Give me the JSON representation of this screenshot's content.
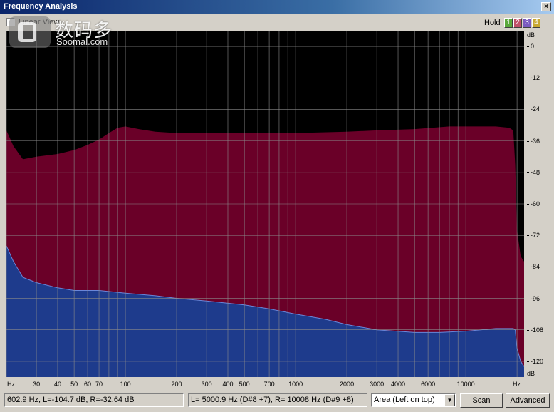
{
  "window": {
    "title": "Frequency Analysis",
    "close_label": "×"
  },
  "toolbar": {
    "linear_view_label": "Linear View",
    "hold_label": "Hold",
    "hold_buttons": [
      {
        "label": "1",
        "color": "#5aa83c"
      },
      {
        "label": "2",
        "color": "#c0506a"
      },
      {
        "label": "3",
        "color": "#7a5abf"
      },
      {
        "label": "4",
        "color": "#c8a832"
      }
    ]
  },
  "watermark": {
    "text_cn": "数码多",
    "text_en": "Soomal.com"
  },
  "chart_data": {
    "type": "area",
    "x_scale": "log",
    "xlim": [
      20,
      22000
    ],
    "ylim": [
      -126,
      6
    ],
    "x_unit": "Hz",
    "y_unit": "dB",
    "x_ticks": [
      {
        "value": 30,
        "label": "30"
      },
      {
        "value": 40,
        "label": "40"
      },
      {
        "value": 50,
        "label": "50"
      },
      {
        "value": 60,
        "label": "60"
      },
      {
        "value": 70,
        "label": "70"
      },
      {
        "value": 100,
        "label": "100"
      },
      {
        "value": 200,
        "label": "200"
      },
      {
        "value": 300,
        "label": "300"
      },
      {
        "value": 400,
        "label": "400"
      },
      {
        "value": 500,
        "label": "500"
      },
      {
        "value": 700,
        "label": "700"
      },
      {
        "value": 1000,
        "label": "1000"
      },
      {
        "value": 2000,
        "label": "2000"
      },
      {
        "value": 3000,
        "label": "3000"
      },
      {
        "value": 4000,
        "label": "4000"
      },
      {
        "value": 6000,
        "label": "6000"
      },
      {
        "value": 10000,
        "label": "10000"
      }
    ],
    "y_ticks": [
      {
        "value": 0,
        "label": "0"
      },
      {
        "value": -12,
        "label": "-12"
      },
      {
        "value": -24,
        "label": "-24"
      },
      {
        "value": -36,
        "label": "-36"
      },
      {
        "value": -48,
        "label": "-48"
      },
      {
        "value": -60,
        "label": "-60"
      },
      {
        "value": -72,
        "label": "-72"
      },
      {
        "value": -84,
        "label": "-84"
      },
      {
        "value": -96,
        "label": "-96"
      },
      {
        "value": -108,
        "label": "-108"
      },
      {
        "value": -120,
        "label": "-120"
      }
    ],
    "grid": true,
    "series": [
      {
        "color": "#6a0028",
        "x": [
          20,
          22,
          25,
          30,
          40,
          50,
          60,
          70,
          80,
          90,
          100,
          120,
          150,
          200,
          300,
          500,
          1000,
          2000,
          3000,
          5000,
          8000,
          10000,
          12000,
          15000,
          18000,
          19000,
          19500,
          20000,
          21000,
          22000
        ],
        "y": [
          -32,
          -38,
          -43,
          -42,
          -41,
          -39.5,
          -37.5,
          -35.5,
          -33,
          -31,
          -30.5,
          -31.5,
          -32.5,
          -33,
          -33,
          -33,
          -33,
          -32.5,
          -32,
          -31.5,
          -30.5,
          -30.5,
          -30.5,
          -30.5,
          -31,
          -32,
          -45,
          -70,
          -80,
          -82
        ]
      },
      {
        "color": "#1e3b8c",
        "x": [
          20,
          22,
          25,
          30,
          40,
          50,
          70,
          100,
          150,
          200,
          300,
          500,
          700,
          1000,
          1500,
          2000,
          3000,
          5000,
          7000,
          10000,
          15000,
          19000,
          19500,
          20000,
          21000,
          22000
        ],
        "y": [
          -76,
          -82,
          -88,
          -90,
          -92,
          -93,
          -93,
          -94,
          -95,
          -96,
          -97,
          -98.5,
          -100,
          -102,
          -104,
          -106,
          -108,
          -109,
          -109,
          -108.5,
          -107.5,
          -107.5,
          -108,
          -115,
          -120,
          -122
        ]
      }
    ]
  },
  "status": {
    "cursor_readout": "602.9 Hz, L=-104.7 dB, R=-32.64 dB",
    "note_readout": "L= 5000.9 Hz (D#8 +7), R=  10008 Hz (D#9 +8)",
    "view_mode_selected": "Area (Left on top)",
    "scan_label": "Scan",
    "advanced_label": "Advanced"
  }
}
